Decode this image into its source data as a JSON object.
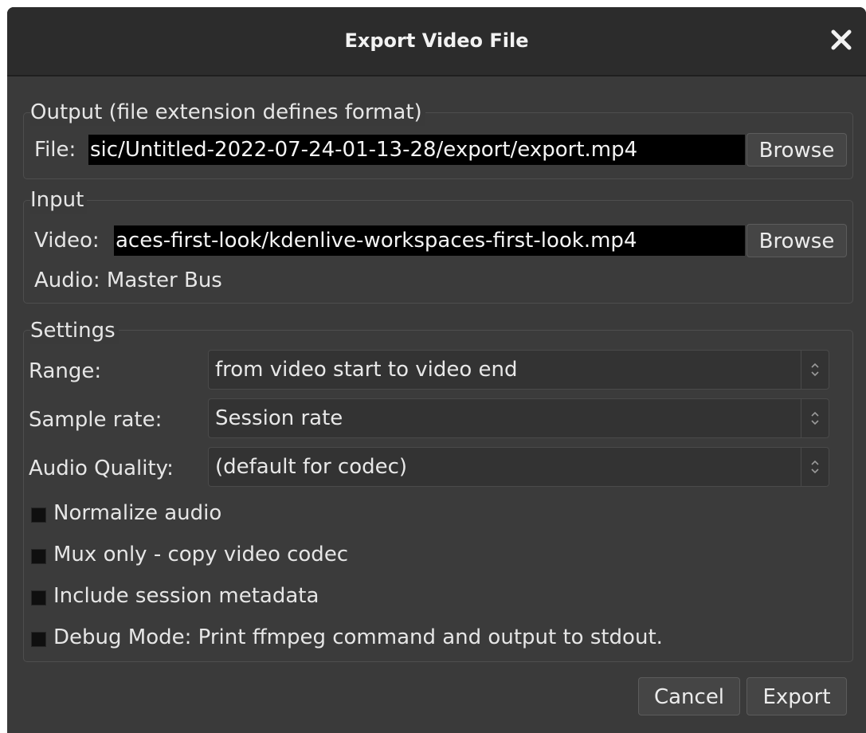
{
  "window": {
    "title": "Export Video File"
  },
  "output": {
    "label": "Output (file extension defines format)",
    "file_label": "File:",
    "file_value": "sic/Untitled-2022-07-24-01-13-28/export/export.mp4",
    "browse_label": "Browse"
  },
  "input": {
    "label": "Input",
    "video_label": "Video:",
    "video_value": "aces-first-look/kdenlive-workspaces-first-look.mp4",
    "browse_label": "Browse",
    "audio_text": "Audio: Master Bus"
  },
  "settings": {
    "label": "Settings",
    "range_label": "Range:",
    "range_value": "from video start to video end",
    "sample_rate_label": "Sample rate:",
    "sample_rate_value": "Session rate",
    "audio_quality_label": "Audio Quality:",
    "audio_quality_value": "(default for codec)",
    "checkboxes": [
      {
        "label": "Normalize audio",
        "checked": false
      },
      {
        "label": "Mux only - copy video codec",
        "checked": false
      },
      {
        "label": "Include session metadata",
        "checked": false
      },
      {
        "label": "Debug Mode: Print ffmpeg command and output to stdout.",
        "checked": false
      }
    ]
  },
  "buttons": {
    "cancel": "Cancel",
    "export": "Export"
  },
  "icons": {
    "close": "close-icon",
    "combo_arrow": "chevron-up-down-icon"
  },
  "colors": {
    "window_bg": "#3a3a3a",
    "titlebar_bg": "#2c2c2c",
    "field_bg": "#000000",
    "text": "#e6e6e6"
  }
}
